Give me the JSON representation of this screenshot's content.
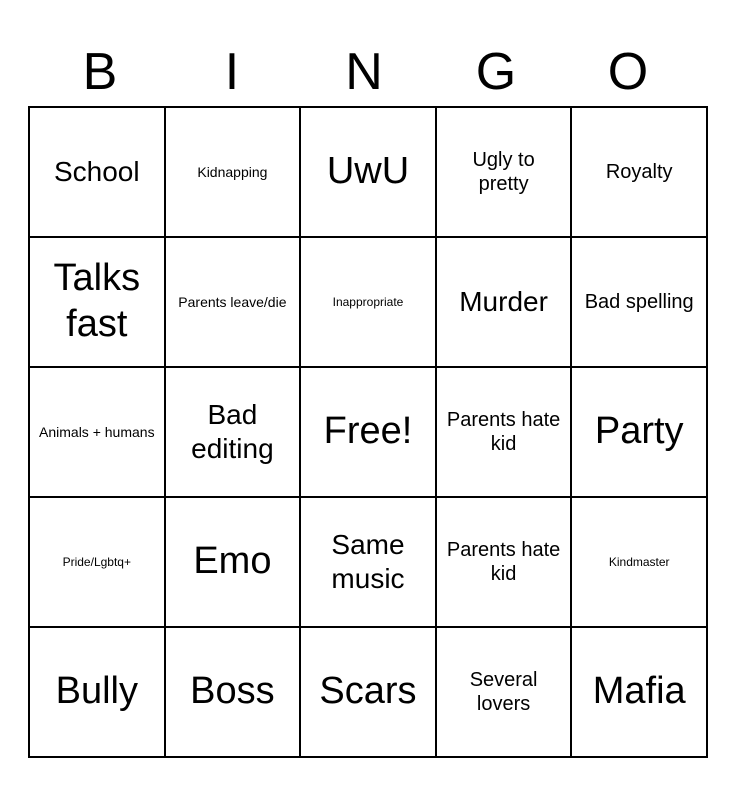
{
  "header": {
    "letters": [
      "B",
      "I",
      "N",
      "G",
      "O"
    ]
  },
  "cells": [
    {
      "text": "School",
      "size": "lg"
    },
    {
      "text": "Kidnapping",
      "size": "sm"
    },
    {
      "text": "UwU",
      "size": "xl"
    },
    {
      "text": "Ugly to pretty",
      "size": "md"
    },
    {
      "text": "Royalty",
      "size": "md"
    },
    {
      "text": "Talks fast",
      "size": "xl"
    },
    {
      "text": "Parents leave/die",
      "size": "sm"
    },
    {
      "text": "Inappropriate",
      "size": "xs"
    },
    {
      "text": "Murder",
      "size": "lg"
    },
    {
      "text": "Bad spelling",
      "size": "md"
    },
    {
      "text": "Animals + humans",
      "size": "sm"
    },
    {
      "text": "Bad editing",
      "size": "lg"
    },
    {
      "text": "Free!",
      "size": "xl"
    },
    {
      "text": "Parents hate kid",
      "size": "md"
    },
    {
      "text": "Party",
      "size": "xl"
    },
    {
      "text": "Pride/Lgbtq+",
      "size": "xs"
    },
    {
      "text": "Emo",
      "size": "xl"
    },
    {
      "text": "Same music",
      "size": "lg"
    },
    {
      "text": "Parents hate kid",
      "size": "md"
    },
    {
      "text": "Kindmaster",
      "size": "xs"
    },
    {
      "text": "Bully",
      "size": "xl"
    },
    {
      "text": "Boss",
      "size": "xl"
    },
    {
      "text": "Scars",
      "size": "xl"
    },
    {
      "text": "Several lovers",
      "size": "md"
    },
    {
      "text": "Mafia",
      "size": "xl"
    }
  ]
}
